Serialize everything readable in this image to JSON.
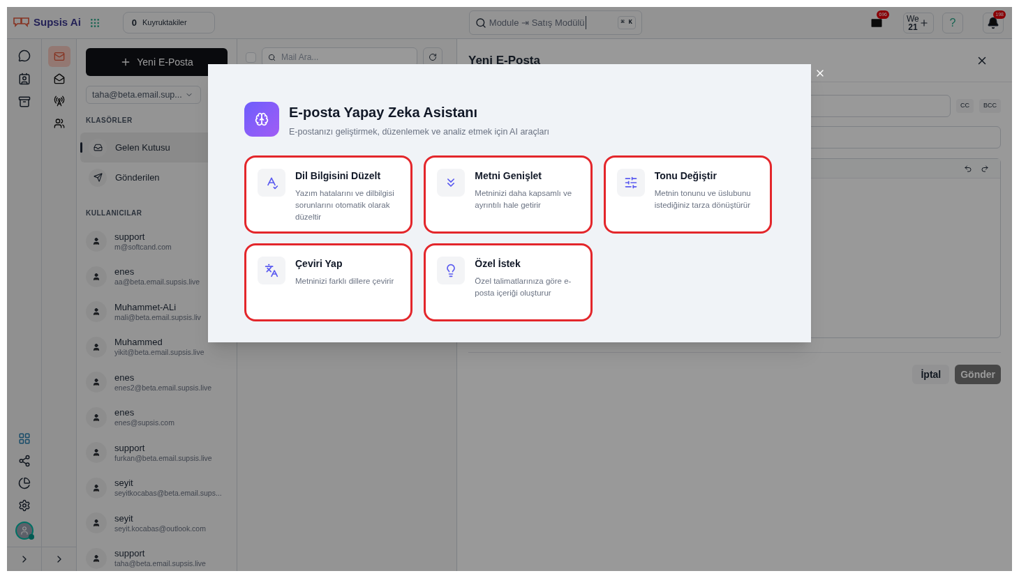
{
  "topbar": {
    "brand": "Supsis Ai",
    "queue": {
      "count": "0",
      "label": "Kuyruktakiler"
    },
    "search": {
      "value": "Module ⇥ Satış Modülü",
      "shortcut": "⌘ K"
    },
    "mail_badge": "696",
    "workspace": {
      "line_1": "We",
      "line_2": "21"
    },
    "notification_badge": "198",
    "help": "?"
  },
  "mail_rail": [
    {
      "selected": true
    },
    {
      "selected": false
    },
    {
      "selected": false
    },
    {
      "selected": false
    }
  ],
  "folders": {
    "new_button": "Yeni E-Posta",
    "account": "taha@beta.email.sup...",
    "heading": "KLASÖRLER",
    "items": [
      {
        "label": "Gelen Kutusu",
        "selected": true
      },
      {
        "label": "Gönderilen",
        "selected": false
      }
    ],
    "users_heading": "KULLANICILAR",
    "users": [
      {
        "name": "support",
        "email": "m@softcand.com"
      },
      {
        "name": "enes",
        "email": "aa@beta.email.supsis.live"
      },
      {
        "name": "Muhammet-ALi",
        "email": "mali@beta.email.supsis.liv"
      },
      {
        "name": "Muhammed",
        "email": "yikit@beta.email.supsis.live"
      },
      {
        "name": "enes",
        "email": "enes2@beta.email.supsis.live"
      },
      {
        "name": "enes",
        "email": "enes@supsis.com"
      },
      {
        "name": "support",
        "email": "furkan@beta.email.supsis.live"
      },
      {
        "name": "seyit",
        "email": "seyitkocabas@beta.email.sups..."
      },
      {
        "name": "seyit",
        "email": "seyit.kocabas@outlook.com"
      },
      {
        "name": "support",
        "email": "taha@beta.email.supsis.live"
      }
    ]
  },
  "mail_list": {
    "select_all_checked": false,
    "search_placeholder": "Mail Ara..."
  },
  "compose": {
    "title": "Yeni E-Posta",
    "cc": "CC",
    "bcc": "BCC",
    "cancel": "İptal",
    "send": "Gönder"
  },
  "modal": {
    "title": "E-posta Yapay Zeka Asistanı",
    "subtitle": "E-postanızı geliştirmek, düzenlemek ve analiz etmek için AI araçları",
    "tools": [
      {
        "kind": "grammar",
        "title": "Dil Bilgisini Düzelt",
        "description": "Yazım hatalarını ve dilbilgisi sorunlarını otomatik olarak düzeltir",
        "highlighted": true
      },
      {
        "kind": "expand",
        "title": "Metni Genişlet",
        "description": "Metninizi daha kapsamlı ve ayrıntılı hale getirir",
        "highlighted": true
      },
      {
        "kind": "tone",
        "title": "Tonu Değiştir",
        "description": "Metnin tonunu ve üslubunu istediğiniz tarza dönüştürür",
        "highlighted": true
      },
      {
        "kind": "translate",
        "title": "Çeviri Yap",
        "description": "Metninizi farklı dillere çevirir",
        "highlighted": true
      },
      {
        "kind": "custom",
        "title": "Özel İstek",
        "description": "Özel talimatlarınıza göre e-posta içeriği oluşturur",
        "highlighted": true
      }
    ]
  }
}
